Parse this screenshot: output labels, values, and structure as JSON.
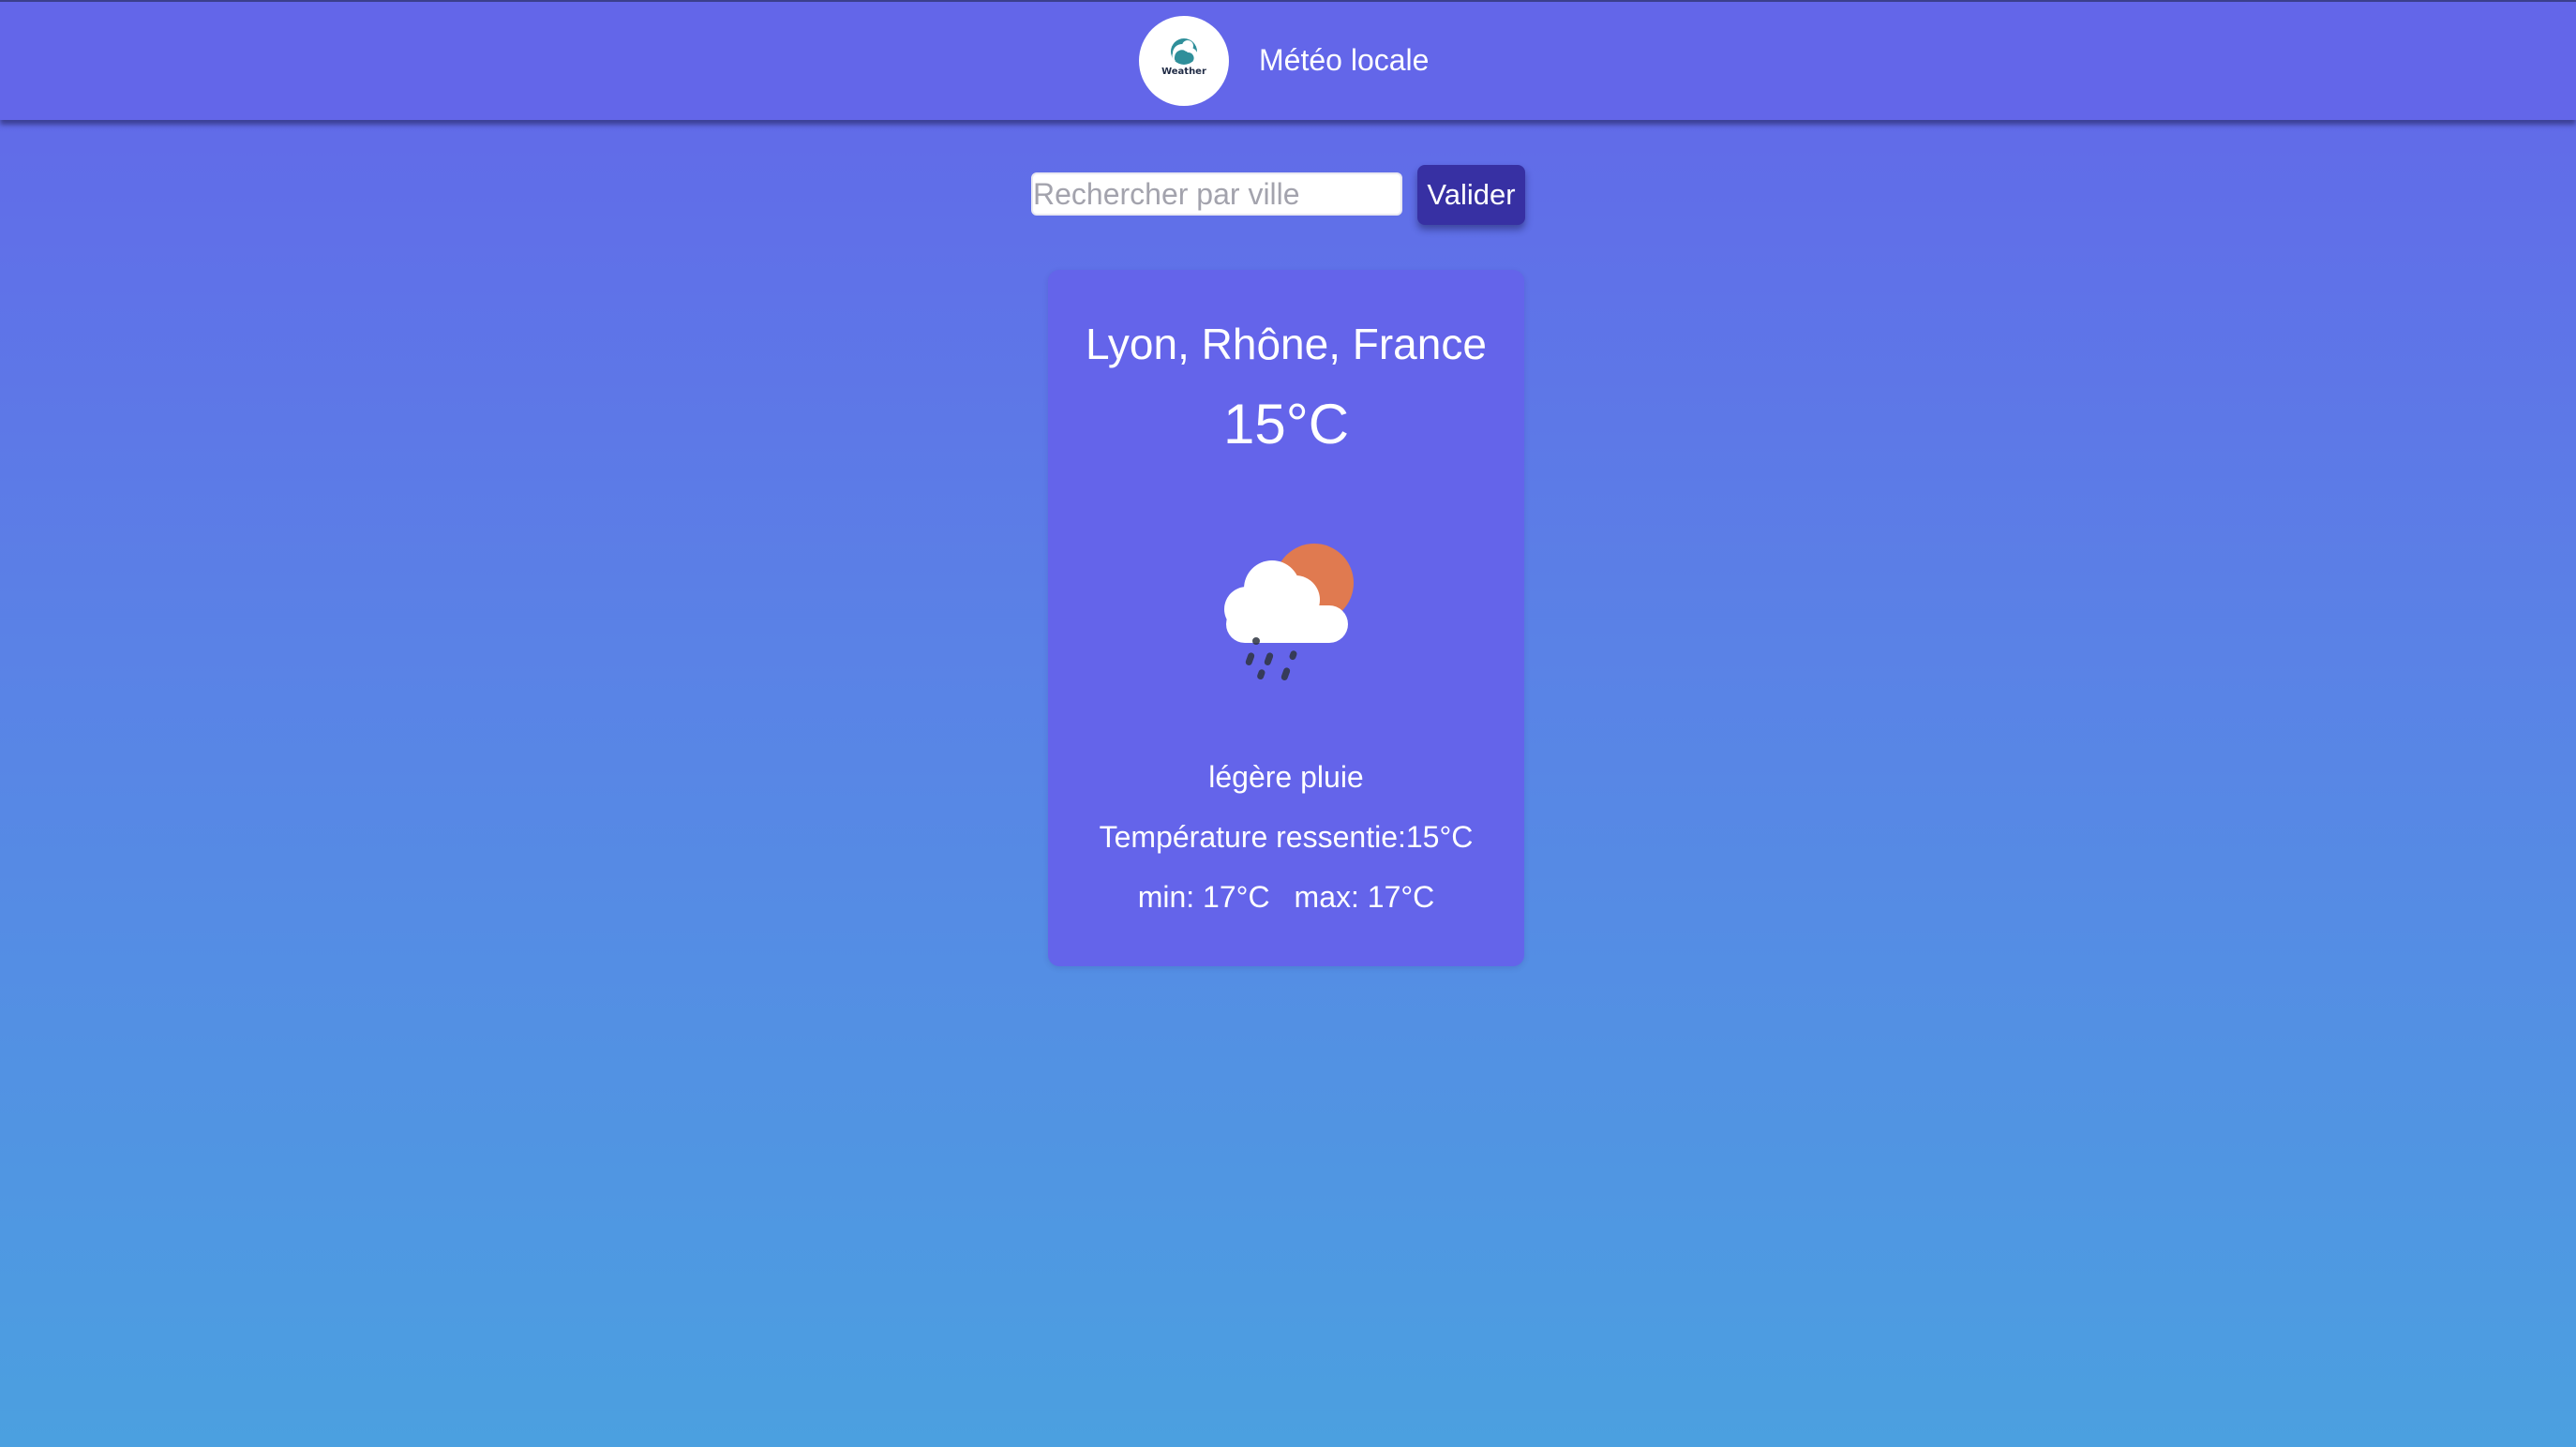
{
  "header": {
    "logo_text": "Weather",
    "title": "Météo locale"
  },
  "search": {
    "placeholder": "Rechercher par ville",
    "value": "",
    "button_label": "Valider"
  },
  "weather": {
    "location": "Lyon, Rhône, France",
    "temperature": "15°C",
    "icon": "cloud-sun-rain-icon",
    "description": "légère pluie",
    "feels_like_label": "Température ressentie:15°C",
    "min_label": "min: 17°C",
    "max_label": "max: 17°C"
  },
  "colors": {
    "header_bg": "#6366e9",
    "card_bg": "#6464ea",
    "button_bg": "#3730a3",
    "gradient_top": "#6366e9",
    "gradient_bottom": "#4ba0e0",
    "sun": "#e07a50"
  }
}
